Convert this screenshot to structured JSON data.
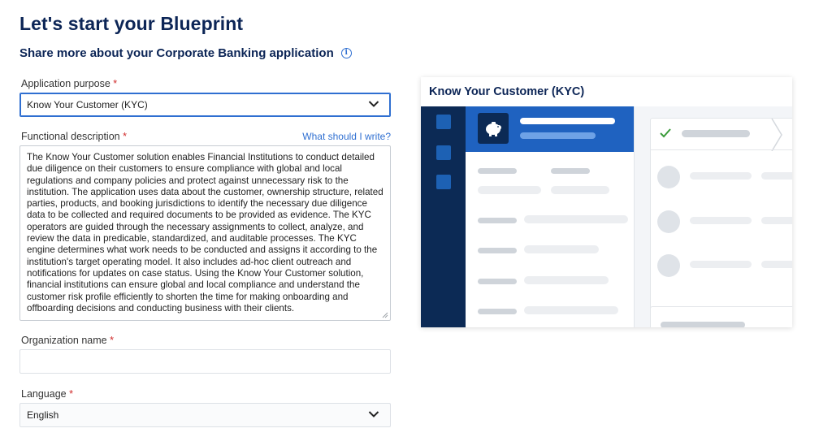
{
  "page": {
    "title": "Let's start your Blueprint",
    "subtitle": "Share more about your Corporate Banking application"
  },
  "form": {
    "purpose": {
      "label": "Application purpose",
      "required": "*",
      "value": "Know Your Customer (KYC)"
    },
    "description": {
      "label": "Functional description",
      "required": "*",
      "help_link": "What should I write?",
      "value": "The Know Your Customer solution enables Financial Institutions to conduct detailed due diligence on their customers to ensure compliance with global and local regulations and company policies and protect against unnecessary risk to the institution.  The application uses data about the customer, ownership structure, related parties, products, and booking jurisdictions to identify the necessary due diligence data to be collected and required documents to be provided as evidence. The KYC operators are guided through the necessary assignments to collect, analyze, and review the data in predicable, standardized, and auditable processes.  The KYC engine determines what work needs to be conducted and assigns it according to the institution's target operating model. It also includes ad-hoc client outreach and notifications for updates on case status.  Using the Know Your Customer solution, financial institutions can ensure global and local compliance and understand the customer risk profile efficiently to shorten the time for making onboarding and offboarding decisions and conducting business with their clients."
    },
    "organization": {
      "label": "Organization name",
      "required": "*",
      "value": ""
    },
    "language": {
      "label": "Language",
      "required": "*",
      "value": "English"
    }
  },
  "preview": {
    "title": "Know Your Customer (KYC)"
  },
  "colors": {
    "brand_navy": "#0c2556",
    "accent_blue": "#1f62c0",
    "link_blue": "#2f6fd1",
    "required_red": "#d02b2b",
    "check_green": "#3a9b3a"
  },
  "icons": {
    "info": "info-icon",
    "dropdown": "chevron-down-icon",
    "check": "check-icon",
    "piggy_bank": "piggy-bank-icon"
  }
}
